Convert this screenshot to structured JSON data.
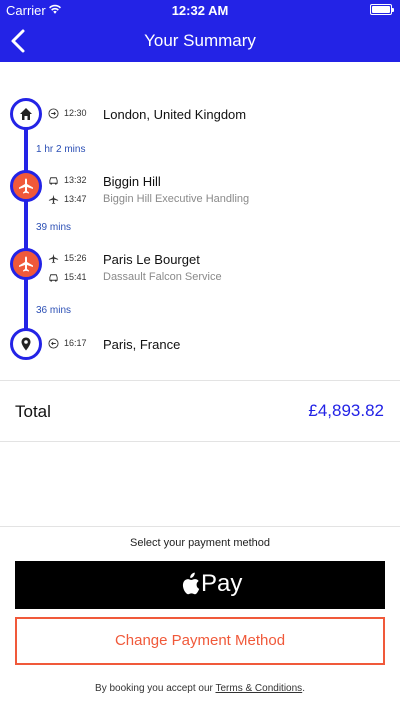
{
  "status_bar": {
    "carrier": "Carrier",
    "time": "12:32 AM"
  },
  "header": {
    "title": "Your Summary"
  },
  "colors": {
    "brand_blue": "#2323e6",
    "accent_orange": "#f0593a",
    "duration_blue": "#2b4fb5"
  },
  "itinerary": {
    "start": {
      "icon": "home-icon",
      "time": "12:30",
      "place": "London, United Kingdom"
    },
    "leg1_duration": "1 hr 2 mins",
    "biggin": {
      "icon": "airplane-icon",
      "car_time": "13:32",
      "plane_time": "13:47",
      "place": "Biggin Hill",
      "handler": "Biggin Hill Executive Handling"
    },
    "leg2_duration": "39 mins",
    "paris_airport": {
      "icon": "airplane-icon",
      "plane_time": "15:26",
      "car_time": "15:41",
      "place": "Paris Le Bourget",
      "handler": "Dassault Falcon Service"
    },
    "leg3_duration": "36 mins",
    "end": {
      "icon": "location-pin-icon",
      "time": "16:17",
      "place": "Paris, France"
    }
  },
  "total": {
    "label": "Total",
    "value": "£4,893.82"
  },
  "payment": {
    "prompt": "Select your payment method",
    "apple_pay_label": "Pay",
    "change_label": "Change Payment Method"
  },
  "terms": {
    "prefix": "By booking you accept our ",
    "link": "Terms & Conditions",
    "suffix": "."
  }
}
